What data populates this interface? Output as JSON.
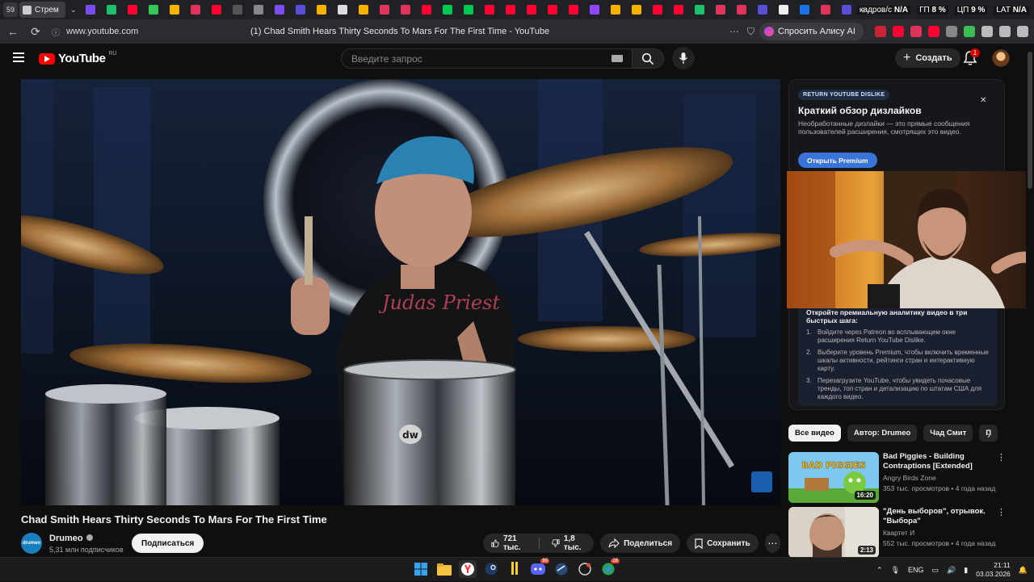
{
  "browser": {
    "tab_count": "59",
    "active_tab_label": "Стрем",
    "url": "www.youtube.com",
    "page_title": "(1) Chad Smith Hears Thirty Seconds To Mars For The First Time - YouTube",
    "alice_label": "Спросить Алису AI",
    "tab_icon_colors": [
      "#7a4df0",
      "#1fbf6b",
      "#ff0033",
      "#34c759",
      "#f5b100",
      "#e0335a",
      "#ff0033",
      "#555",
      "#888",
      "#7a4df0",
      "#5a4dd6",
      "#f5b100",
      "#ddd",
      "#f5b100",
      "#e0335a",
      "#e0335a",
      "#ff0033",
      "#00c853",
      "#00c853",
      "#ff0033",
      "#ff0033",
      "#ff0033",
      "#ff0033",
      "#ff0033",
      "#9146ff",
      "#f5b100",
      "#f5b100",
      "#ff0033",
      "#ff0033",
      "#1fbf6b",
      "#e0335a",
      "#e0335a",
      "#5a4dd6",
      "#eee",
      "#1a73e8",
      "#e0335a",
      "#5a4dd6"
    ],
    "stats": [
      {
        "label": "кадров/с",
        "value": "N/A"
      },
      {
        "label": "ГП",
        "value": "8 %"
      },
      {
        "label": "ЦП",
        "value": "9 %"
      },
      {
        "label": "LAT",
        "value": "N/A"
      }
    ],
    "extension_colors": [
      "#cc2233",
      "#ff0033",
      "#e0335a",
      "#ff0033",
      "#888",
      "#3dbb55",
      "#bbb",
      "#bbb",
      "#bbb"
    ]
  },
  "youtube": {
    "logo_text": "YouTube",
    "region": "RU",
    "search_placeholder": "Введите запрос",
    "create_label": "Создать",
    "notification_count": "1"
  },
  "video": {
    "title": "Chad Smith Hears Thirty Seconds To Mars For The First Time",
    "channel_name": "Drumeo",
    "channel_avatar_text": "drumeo",
    "subscribers": "5,31 млн подписчиков",
    "subscribe_label": "Подписаться",
    "likes": "721 тыс.",
    "dislikes": "1,8 тыс.",
    "share_label": "Поделиться",
    "save_label": "Сохранить",
    "shirt_text": "Judas Priest",
    "drum_brand": "dw"
  },
  "ryd": {
    "badge": "RETURN YOUTUBE DISLIKE",
    "title": "Краткий обзор дизлайков",
    "description": "Необработанные дизлайки — это прямые сообщения пользователей расширения, смотрящих это видео.",
    "button": "Открыть Premium",
    "steps_title": "Откройте премиальную аналитику видео в три быстрых шага:",
    "steps": [
      {
        "num": "1.",
        "text": "Войдите через Patreon во всплывающем окне расширения Return YouTube Dislike."
      },
      {
        "num": "2.",
        "text": "Выберите уровень Premium, чтобы включить временные шкалы активности, рейтинги стран и интерактивную карту."
      },
      {
        "num": "3.",
        "text": "Перезагрузите YouTube, чтобы увидеть почасовые тренды, топ стран и детализацию по штатам США для каждого видео."
      }
    ]
  },
  "chips": [
    "Все видео",
    "Автор: Drumeo",
    "Чад Смит",
    "П"
  ],
  "recommendations": [
    {
      "title": "Bad Piggies - Building Contraptions [Extended]",
      "channel": "Angry Birds Zone",
      "meta": "353 тыс. просмотров • 4 года назад",
      "duration": "16:20",
      "thumb_text": "BAD PIGGIES"
    },
    {
      "title": "\"День выборов\", отрывок. \"Выбора\"",
      "channel": "Квартет И",
      "meta": "552 тыс. просмотров • 4 года назад",
      "duration": "2:13",
      "thumb_text": ""
    }
  ],
  "taskbar": {
    "lang": "ENG",
    "time": "21:11",
    "date": "03.03.2026",
    "discord_badge": "99",
    "chrome_badge": "28"
  }
}
